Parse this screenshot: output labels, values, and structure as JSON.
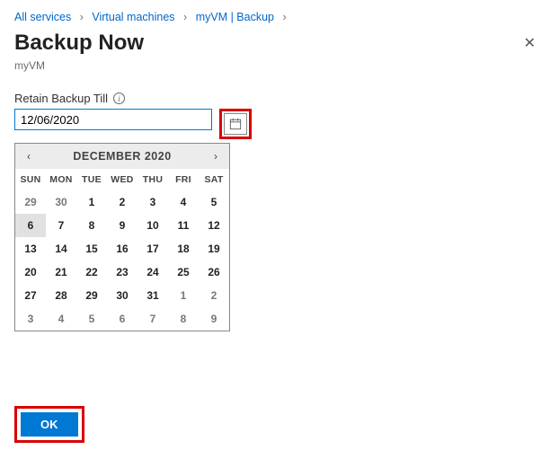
{
  "breadcrumb": {
    "items": [
      "All services",
      "Virtual machines",
      "myVM | Backup"
    ]
  },
  "header": {
    "title": "Backup Now",
    "subtitle": "myVM"
  },
  "field": {
    "label": "Retain Backup Till",
    "value": "12/06/2020"
  },
  "calendar": {
    "title": "DECEMBER 2020",
    "dow": [
      "SUN",
      "MON",
      "TUE",
      "WED",
      "THU",
      "FRI",
      "SAT"
    ],
    "rows": [
      [
        {
          "n": "29",
          "o": true
        },
        {
          "n": "30",
          "o": true
        },
        {
          "n": "1"
        },
        {
          "n": "2"
        },
        {
          "n": "3"
        },
        {
          "n": "4"
        },
        {
          "n": "5"
        }
      ],
      [
        {
          "n": "6",
          "sel": true
        },
        {
          "n": "7"
        },
        {
          "n": "8"
        },
        {
          "n": "9"
        },
        {
          "n": "10"
        },
        {
          "n": "11"
        },
        {
          "n": "12"
        }
      ],
      [
        {
          "n": "13"
        },
        {
          "n": "14"
        },
        {
          "n": "15"
        },
        {
          "n": "16"
        },
        {
          "n": "17"
        },
        {
          "n": "18"
        },
        {
          "n": "19"
        }
      ],
      [
        {
          "n": "20"
        },
        {
          "n": "21"
        },
        {
          "n": "22"
        },
        {
          "n": "23"
        },
        {
          "n": "24"
        },
        {
          "n": "25"
        },
        {
          "n": "26"
        }
      ],
      [
        {
          "n": "27"
        },
        {
          "n": "28"
        },
        {
          "n": "29"
        },
        {
          "n": "30"
        },
        {
          "n": "31"
        },
        {
          "n": "1",
          "o": true
        },
        {
          "n": "2",
          "o": true
        }
      ],
      [
        {
          "n": "3",
          "o": true
        },
        {
          "n": "4",
          "o": true
        },
        {
          "n": "5",
          "o": true
        },
        {
          "n": "6",
          "o": true
        },
        {
          "n": "7",
          "o": true
        },
        {
          "n": "8",
          "o": true
        },
        {
          "n": "9",
          "o": true
        }
      ]
    ]
  },
  "footer": {
    "ok_label": "OK"
  },
  "glyphs": {
    "chev": "›",
    "close": "✕",
    "prev": "‹",
    "next": "›",
    "info": "i"
  }
}
